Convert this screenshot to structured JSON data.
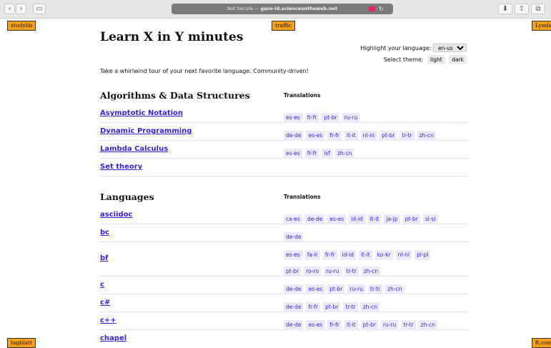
{
  "browser": {
    "address": "Not Secure — ",
    "host": "gaze-id.scienceontheweb.net"
  },
  "ads": {
    "top_left": "studylib",
    "top_center": "traffic",
    "top_right": "Lynda",
    "bottom_left": "tagblatt",
    "bottom_right": "ft.com"
  },
  "page": {
    "title": "Learn X in Y minutes",
    "highlight_label": "Highlight your language:",
    "highlight_value": "en-us",
    "theme_label": "Select theme:",
    "theme_light": "light",
    "theme_dark": "dark",
    "intro": "Take a whirlwind tour of your next favorite language. Community-driven!"
  },
  "sections": [
    {
      "heading": "Algorithms & Data Structures",
      "translations_heading": "Translations",
      "rows": [
        {
          "name": "Asymptotic Notation",
          "lines": [
            [
              "es-es",
              "fr-fr",
              "pt-br",
              "ru-ru"
            ]
          ]
        },
        {
          "name": "Dynamic Programming",
          "lines": [
            [
              "de-de",
              "es-es",
              "fr-fr",
              "it-it",
              "nl-nl",
              "pt-br",
              "tr-tr",
              "zh-cn"
            ]
          ]
        },
        {
          "name": "Lambda Calculus",
          "lines": [
            [
              "es-es",
              "fr-fr",
              "lsf",
              "zh-cn"
            ]
          ]
        },
        {
          "name": "Set theory",
          "lines": []
        }
      ]
    },
    {
      "heading": "Languages",
      "translations_heading": "Translations",
      "rows": [
        {
          "name": "asciidoc",
          "lines": [
            [
              "ca-es",
              "de-de",
              "es-es",
              "id-id",
              "it-it",
              "ja-jp",
              "pt-br",
              "sl-si"
            ]
          ]
        },
        {
          "name": "bc",
          "lines": [
            [
              "de-de"
            ]
          ]
        },
        {
          "name": "bf",
          "lines": [
            [
              "es-es",
              "fa-ir",
              "fr-fr",
              "id-id",
              "it-it",
              "ko-kr",
              "nl-nl",
              "pl-pl"
            ],
            [
              "pt-br",
              "ro-ro",
              "ru-ru",
              "tr-tr",
              "zh-cn"
            ]
          ]
        },
        {
          "name": "c",
          "lines": [
            [
              "de-de",
              "es-es",
              "pt-br",
              "ru-ru",
              "tr-tr",
              "zh-cn"
            ]
          ]
        },
        {
          "name": "c#",
          "lines": [
            [
              "de-de",
              "fr-fr",
              "pt-br",
              "tr-tr",
              "zh-cn"
            ]
          ]
        },
        {
          "name": "c++",
          "lines": [
            [
              "de-de",
              "es-es",
              "fr-fr",
              "it-it",
              "pt-br",
              "ru-ru",
              "tr-tr",
              "zh-cn"
            ]
          ]
        },
        {
          "name": "chapel",
          "lines": []
        }
      ]
    }
  ]
}
